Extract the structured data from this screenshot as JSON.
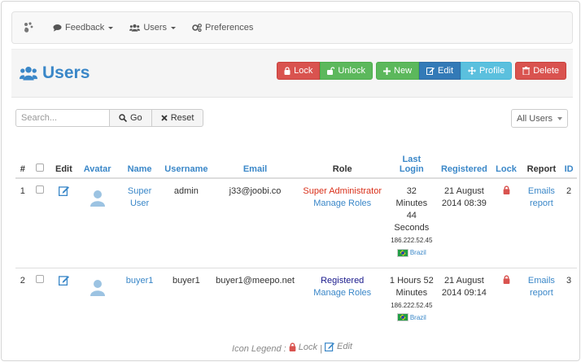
{
  "nav": {
    "items": [
      {
        "label": "Feedback",
        "icon": "comment-icon",
        "dropdown": true
      },
      {
        "label": "Users",
        "icon": "users-icon",
        "dropdown": true
      },
      {
        "label": "Preferences",
        "icon": "cogs-icon",
        "dropdown": false
      }
    ]
  },
  "header": {
    "title": "Users",
    "buttons": {
      "lock": "Lock",
      "unlock": "Unlock",
      "new": "New",
      "edit": "Edit",
      "profile": "Profile",
      "delete": "Delete"
    }
  },
  "search": {
    "placeholder": "Search...",
    "go": "Go",
    "reset": "Reset",
    "filter": "All Users"
  },
  "table": {
    "headers": {
      "num": "#",
      "edit": "Edit",
      "avatar": "Avatar",
      "name": "Name",
      "username": "Username",
      "email": "Email",
      "role": "Role",
      "last_login_1": "Last",
      "last_login_2": "Login",
      "registered": "Registered",
      "lock": "Lock",
      "report": "Report",
      "id": "ID"
    },
    "rows": [
      {
        "num": "1",
        "name_1": "Super",
        "name_2": "User",
        "username": "admin",
        "email": "j33@joobi.co",
        "role": "Super Administrator",
        "manage": "Manage Roles",
        "login_1": "32",
        "login_2": "Minutes",
        "login_3": "44",
        "login_4": "Seconds",
        "ip": "186.222.52.45",
        "country": "Brazil",
        "reg_1": "21 August",
        "reg_2": "2014 08:39",
        "report_1": "Emails",
        "report_2": "report",
        "id": "2"
      },
      {
        "num": "2",
        "name_1": "buyer1",
        "username": "buyer1",
        "email": "buyer1@meepo.net",
        "role": "Registered",
        "manage": "Manage Roles",
        "login_1": "1 Hours 52",
        "login_2": "Minutes",
        "ip": "186.222.52.45",
        "country": "Brazil",
        "reg_1": "21 August",
        "reg_2": "2014 09:14",
        "report_1": "Emails",
        "report_2": "report",
        "id": "3"
      }
    ]
  },
  "legend": {
    "prefix": "Icon Legend :",
    "lock": "Lock",
    "separator": "|",
    "edit": "Edit"
  },
  "colors": {
    "link": "#3a87c8",
    "danger": "#d9534f",
    "success": "#5cb85c",
    "primary": "#337ab7",
    "info": "#5bc0de"
  }
}
